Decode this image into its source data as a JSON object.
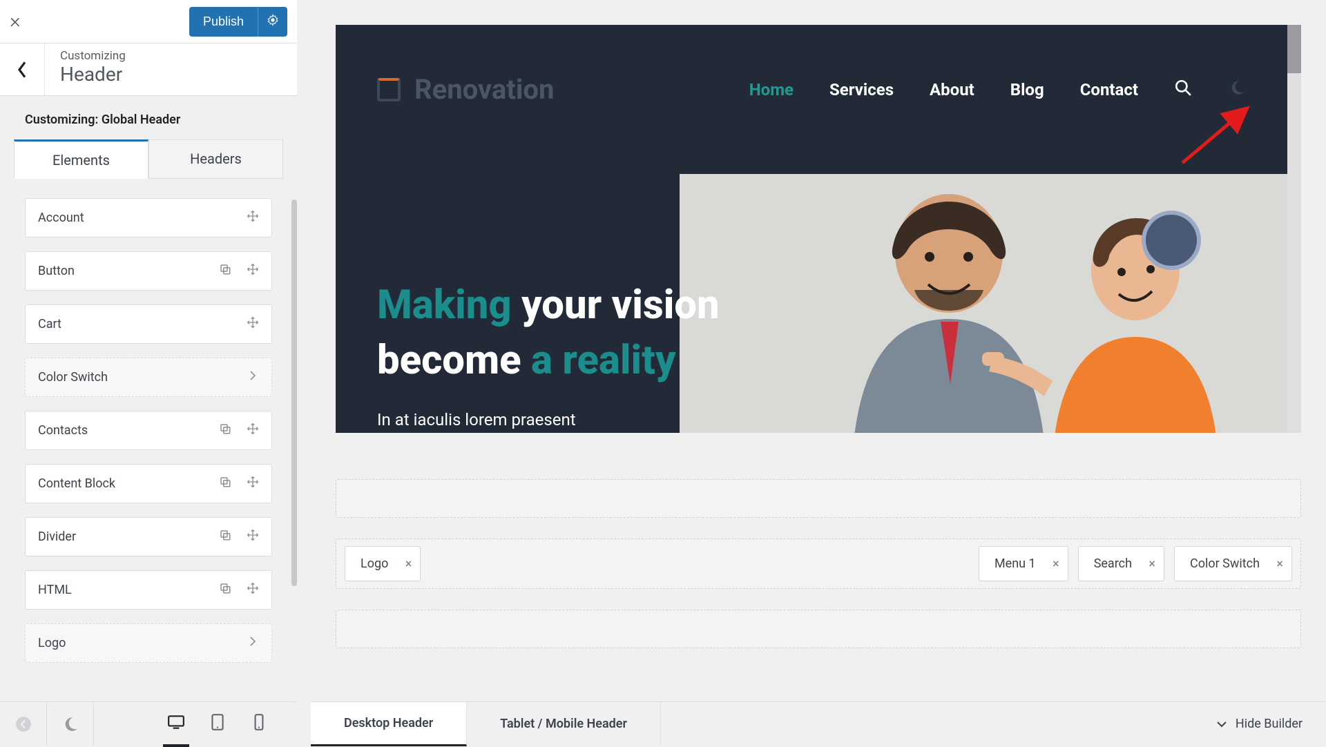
{
  "panel": {
    "publish_label": "Publish",
    "customizing_small": "Customizing",
    "section_title": "Header",
    "heading": "Customizing: Global Header",
    "tabs": {
      "elements": "Elements",
      "headers": "Headers"
    },
    "elements": [
      {
        "label": "Account",
        "style": "solid",
        "icons": [
          "move"
        ]
      },
      {
        "label": "Button",
        "style": "solid",
        "icons": [
          "copy",
          "move"
        ]
      },
      {
        "label": "Cart",
        "style": "solid",
        "icons": [
          "move"
        ]
      },
      {
        "label": "Color Switch",
        "style": "dashed",
        "icons": [
          "chev"
        ]
      },
      {
        "label": "Contacts",
        "style": "solid",
        "icons": [
          "copy",
          "move"
        ]
      },
      {
        "label": "Content Block",
        "style": "solid",
        "icons": [
          "copy",
          "move"
        ]
      },
      {
        "label": "Divider",
        "style": "solid",
        "icons": [
          "copy",
          "move"
        ]
      },
      {
        "label": "HTML",
        "style": "solid",
        "icons": [
          "copy",
          "move"
        ]
      },
      {
        "label": "Logo",
        "style": "dashed",
        "icons": [
          "chev"
        ]
      }
    ]
  },
  "preview": {
    "brand": "Renovation",
    "nav": [
      "Home",
      "Services",
      "About",
      "Blog",
      "Contact"
    ],
    "nav_active": "Home",
    "hero_line1_accent": "Making",
    "hero_line1_rest": "your vision",
    "hero_line2_rest": "become",
    "hero_line2_accent": "a reality",
    "hero_p": "In at iaculis lorem praesent"
  },
  "builder": {
    "left_chips": [
      "Logo"
    ],
    "right_chips": [
      "Menu 1",
      "Search",
      "Color Switch"
    ],
    "tabs": {
      "desktop": "Desktop Header",
      "mobile": "Tablet / Mobile Header"
    },
    "hide": "Hide Builder"
  }
}
